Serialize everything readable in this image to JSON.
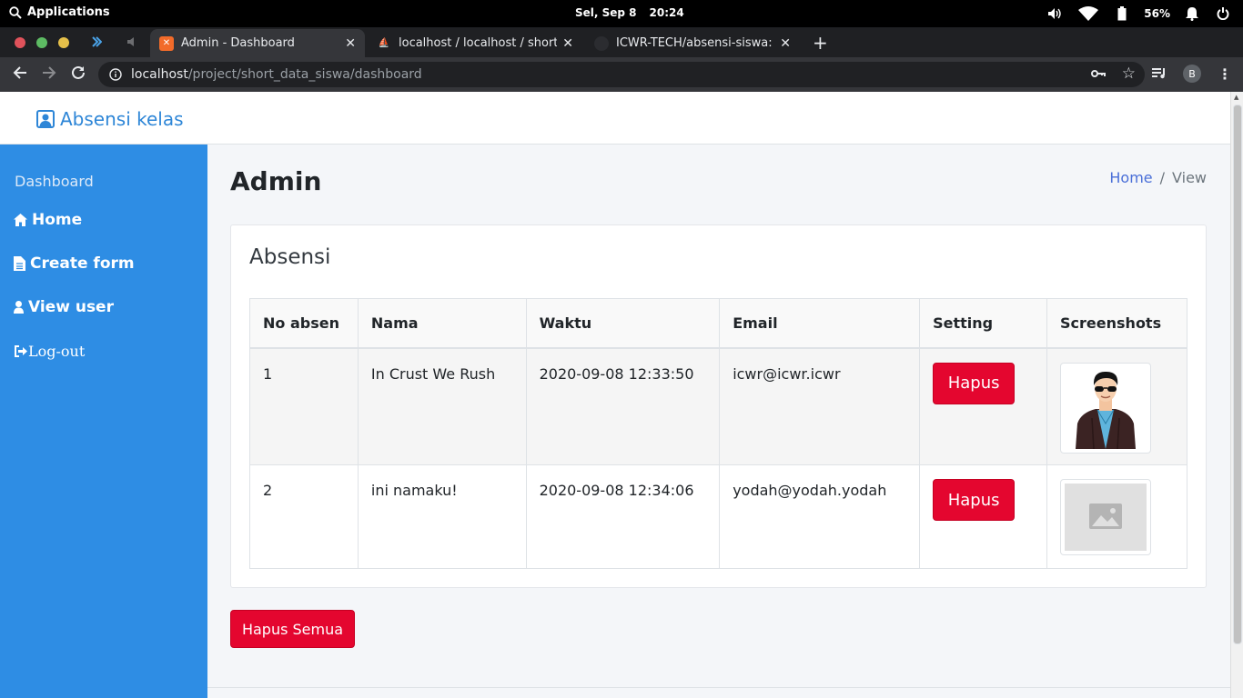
{
  "os": {
    "apps_label": "Applications",
    "date": "Sel, Sep  8",
    "time": "20:24",
    "battery": "56%"
  },
  "browser": {
    "tabs": [
      {
        "title": "Admin - Dashboard",
        "active": true
      },
      {
        "title": "localhost / localhost / shortdata",
        "active": false
      },
      {
        "title": "ICWR-TECH/absensi-siswa: Abs",
        "active": false
      }
    ],
    "url_host": "localhost",
    "url_path": "/project/short_data_siswa/dashboard",
    "profile_initial": "B"
  },
  "app": {
    "brand": "Absensi kelas",
    "sidebar": {
      "heading": "Dashboard",
      "items": [
        {
          "label": "Home",
          "icon": "home-icon"
        },
        {
          "label": "Create form",
          "icon": "file-icon"
        },
        {
          "label": "View user",
          "icon": "user-icon"
        },
        {
          "label": "Log-out",
          "icon": "sign-out-icon"
        }
      ]
    },
    "page_title": "Admin",
    "breadcrumb": {
      "home": "Home",
      "sep": "/",
      "current": "View"
    },
    "card_title": "Absensi",
    "table": {
      "headers": [
        "No absen",
        "Nama",
        "Waktu",
        "Email",
        "Setting",
        "Screenshots"
      ],
      "rows": [
        {
          "no": "1",
          "nama": "In Crust We Rush",
          "waktu": "2020-09-08 12:33:50",
          "email": "icwr@icwr.icwr",
          "action": "Hapus",
          "screenshot": "avatar-man-sunglasses"
        },
        {
          "no": "2",
          "nama": "ini namaku!",
          "waktu": "2020-09-08 12:34:06",
          "email": "yodah@yodah.yodah",
          "action": "Hapus",
          "screenshot": "image-placeholder"
        }
      ]
    },
    "delete_all": "Hapus Semua"
  },
  "colors": {
    "sidebar": "#2e8de4",
    "danger": "#e4062f",
    "brand": "#2e86d7"
  }
}
